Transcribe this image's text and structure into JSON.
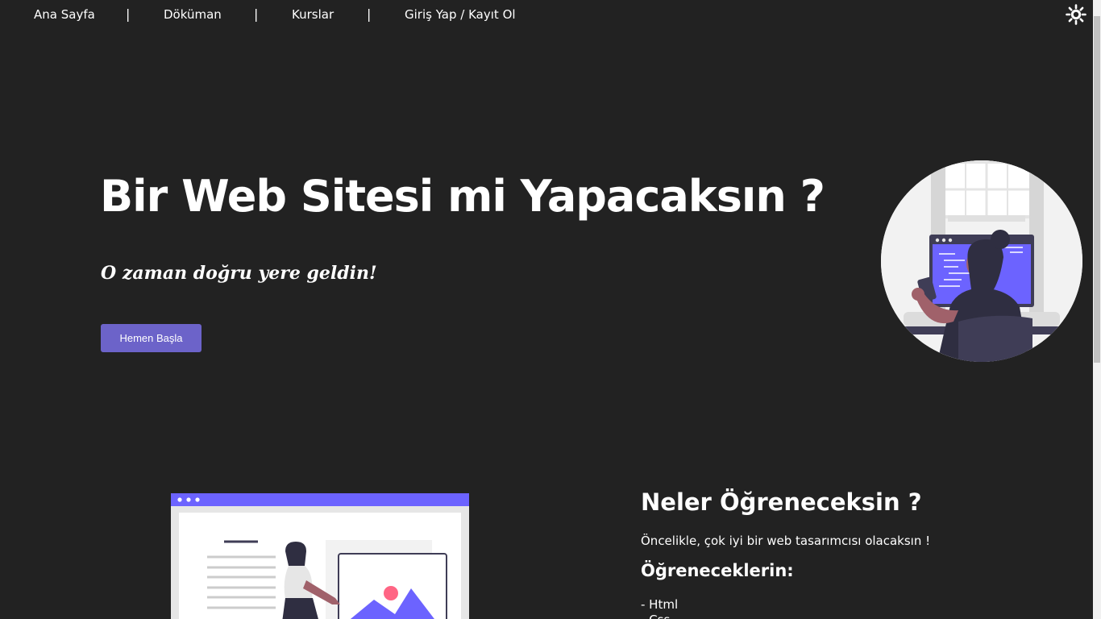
{
  "navbar": {
    "links": [
      {
        "label": "Ana Sayfa"
      },
      {
        "label": "Döküman"
      },
      {
        "label": "Kurslar"
      },
      {
        "label": "Giriş Yap / Kayıt Ol"
      }
    ],
    "separator": "|",
    "theme_toggle_icon": "sun-icon"
  },
  "hero": {
    "title": "Bir Web Sitesi mi Yapacaksın ?",
    "subtitle": "O zaman doğru yere geldin!",
    "cta_label": "Hemen Başla",
    "illustration": "woman-coding-at-computer-illustration"
  },
  "learn": {
    "title": "Neler Öğreneceksin ?",
    "intro": "Öncelikle, çok iyi bir web tasarımcısı olacaksın !",
    "subheading": "Öğreneceklerin:",
    "items": [
      "- Html",
      "- Css"
    ],
    "illustration": "website-builder-illustration"
  },
  "colors": {
    "background": "#222222",
    "accent": "#6c63ff",
    "button": "#6c63c9",
    "text": "#ffffff"
  }
}
